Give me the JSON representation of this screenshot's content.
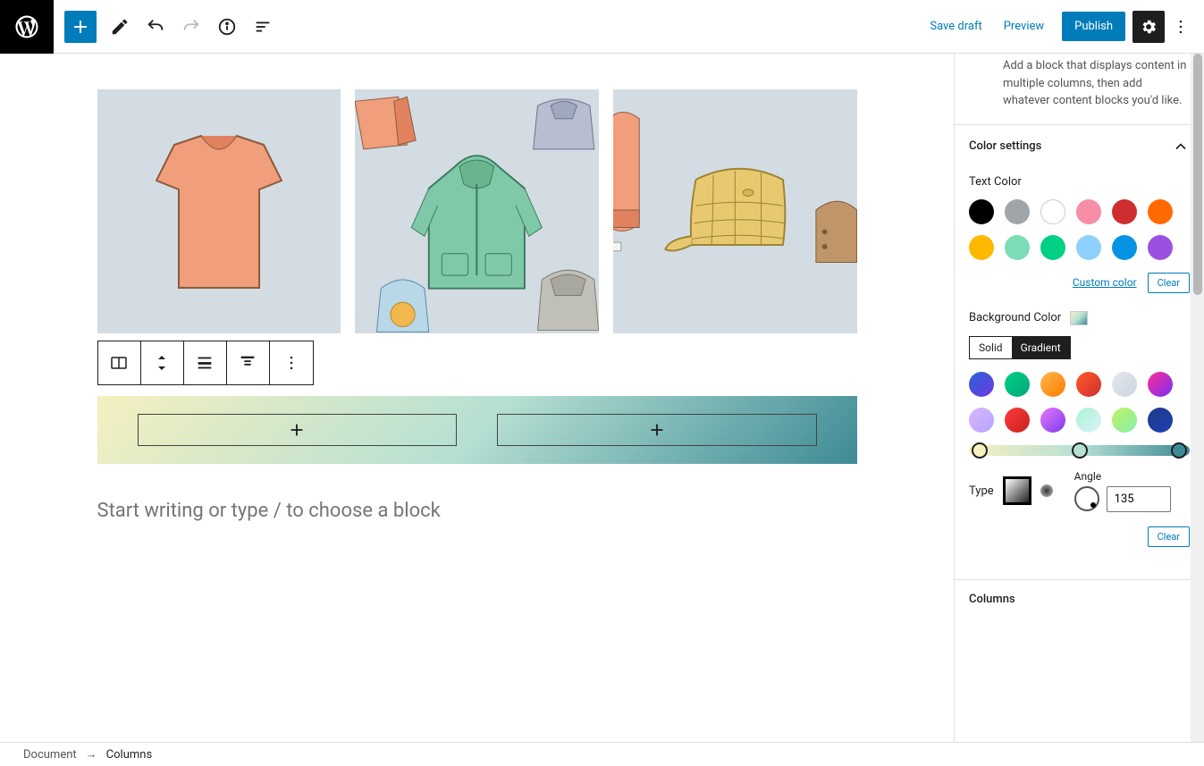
{
  "topbar": {
    "save_draft": "Save draft",
    "preview": "Preview",
    "publish": "Publish"
  },
  "sidebar": {
    "block_desc": "Add a block that displays content in multiple columns, then add whatever content blocks you'd like.",
    "color_settings": "Color settings",
    "text_color": "Text Color",
    "custom_color": "Custom color",
    "clear": "Clear",
    "background_color": "Background Color",
    "solid": "Solid",
    "gradient": "Gradient",
    "type": "Type",
    "angle": "Angle",
    "angle_value": "135",
    "columns": "Columns",
    "text_swatches": [
      "#000000",
      "#a0a5aa",
      "#ffffff",
      "#f78da7",
      "#cf2e2e",
      "#ff6900",
      "#fcb900",
      "#7bdcb5",
      "#00d084",
      "#8ed1fc",
      "#0693e3",
      "#9b51e0"
    ],
    "gradient_swatches": [
      "linear-gradient(135deg,#2a61d6,#6b3ce0)",
      "linear-gradient(135deg,#00d084,#06a77d)",
      "linear-gradient(135deg,#ffb84d,#ff7a00)",
      "linear-gradient(135deg,#ff5c2b,#cf2e2e)",
      "linear-gradient(135deg,#e5e7eb,#cbd5e1)",
      "linear-gradient(135deg,#ff2d95,#7b2ff7)",
      "linear-gradient(135deg,#d7b8ff,#b8a3ff)",
      "linear-gradient(135deg,#ff3b3b,#c62020)",
      "linear-gradient(135deg,#e879f9,#7c3aed)",
      "linear-gradient(135deg,#a7f3d0,#e0f2fe)",
      "linear-gradient(135deg,#bef264,#86efac)",
      "linear-gradient(135deg,#1e3a8a,#1e40af)"
    ]
  },
  "canvas": {
    "placeholder": "Start writing or type / to choose a block"
  },
  "breadcrumb": {
    "root": "Document",
    "current": "Columns"
  },
  "chart_data": null
}
